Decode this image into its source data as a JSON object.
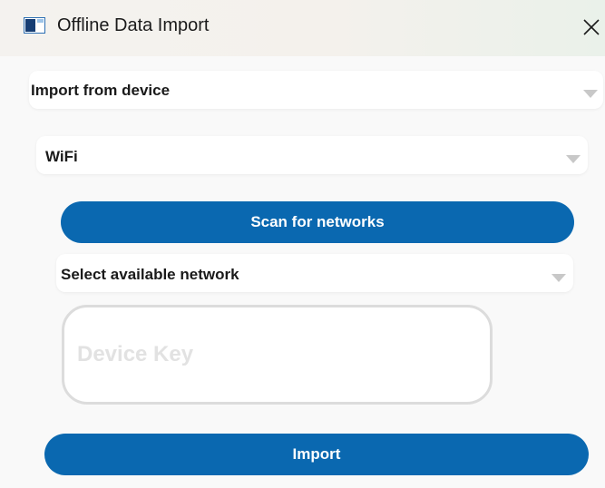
{
  "window": {
    "title": "Offline Data Import",
    "close_symbol": "✕"
  },
  "source_select": {
    "value": "Import from device"
  },
  "connection_select": {
    "value": "WiFi"
  },
  "scan_button": {
    "label": "Scan for networks"
  },
  "network_select": {
    "value": "Select available network"
  },
  "device_key": {
    "placeholder": "Device Key",
    "value": ""
  },
  "import_button": {
    "label": "Import"
  },
  "colors": {
    "accent": "#0a68b0",
    "placeholder": "#e2e2e2",
    "caret": "#c8c8c8"
  },
  "icons": [
    "app-window-icon",
    "close-icon",
    "dropdown-arrow-icon"
  ]
}
